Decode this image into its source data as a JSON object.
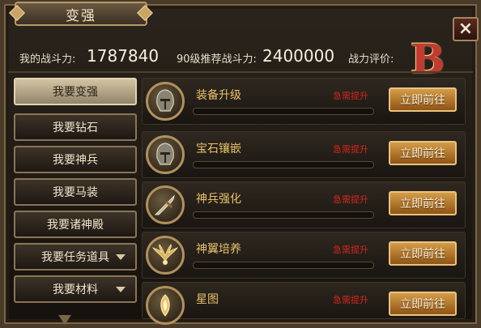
{
  "window": {
    "title": "变强",
    "close_icon": "close-icon",
    "close_label": "×"
  },
  "stats": {
    "power_label": "我的战斗力:",
    "power_value": "1787840",
    "recommend_label": "90级推荐战斗力:",
    "recommend_value": "2400000",
    "rating_label": "战力评价:",
    "rating_value": "B"
  },
  "menu": {
    "items": [
      {
        "label": "我要变强",
        "active": true,
        "dropdown": false
      },
      {
        "label": "我要钻石",
        "active": false,
        "dropdown": false
      },
      {
        "label": "我要神兵",
        "active": false,
        "dropdown": false
      },
      {
        "label": "我要马装",
        "active": false,
        "dropdown": false
      },
      {
        "label": "我要诸神殿",
        "active": false,
        "dropdown": false
      },
      {
        "label": "我要任务道具",
        "active": false,
        "dropdown": true
      },
      {
        "label": "我要材料",
        "active": false,
        "dropdown": true
      }
    ]
  },
  "rows": [
    {
      "title": "装备升级",
      "status": "急需提升",
      "button": "立即前往",
      "icon": "helmet-icon",
      "progress": 0
    },
    {
      "title": "宝石镶嵌",
      "status": "急需提升",
      "button": "立即前往",
      "icon": "helmet-icon",
      "progress": 0
    },
    {
      "title": "神兵强化",
      "status": "急需提升",
      "button": "立即前往",
      "icon": "sword-icon",
      "progress": 0
    },
    {
      "title": "神翼培养",
      "status": "急需提升",
      "button": "立即前往",
      "icon": "wings-icon",
      "progress": 0
    },
    {
      "title": "星图",
      "status": "急需提升",
      "button": "立即前往",
      "icon": "star-chart-icon",
      "progress": 0
    }
  ],
  "colors": {
    "accent_gold": "#e9c26a",
    "urgent_red": "#d3261d",
    "button_orange": "#c98a36",
    "grade_red": "#c33a30"
  }
}
